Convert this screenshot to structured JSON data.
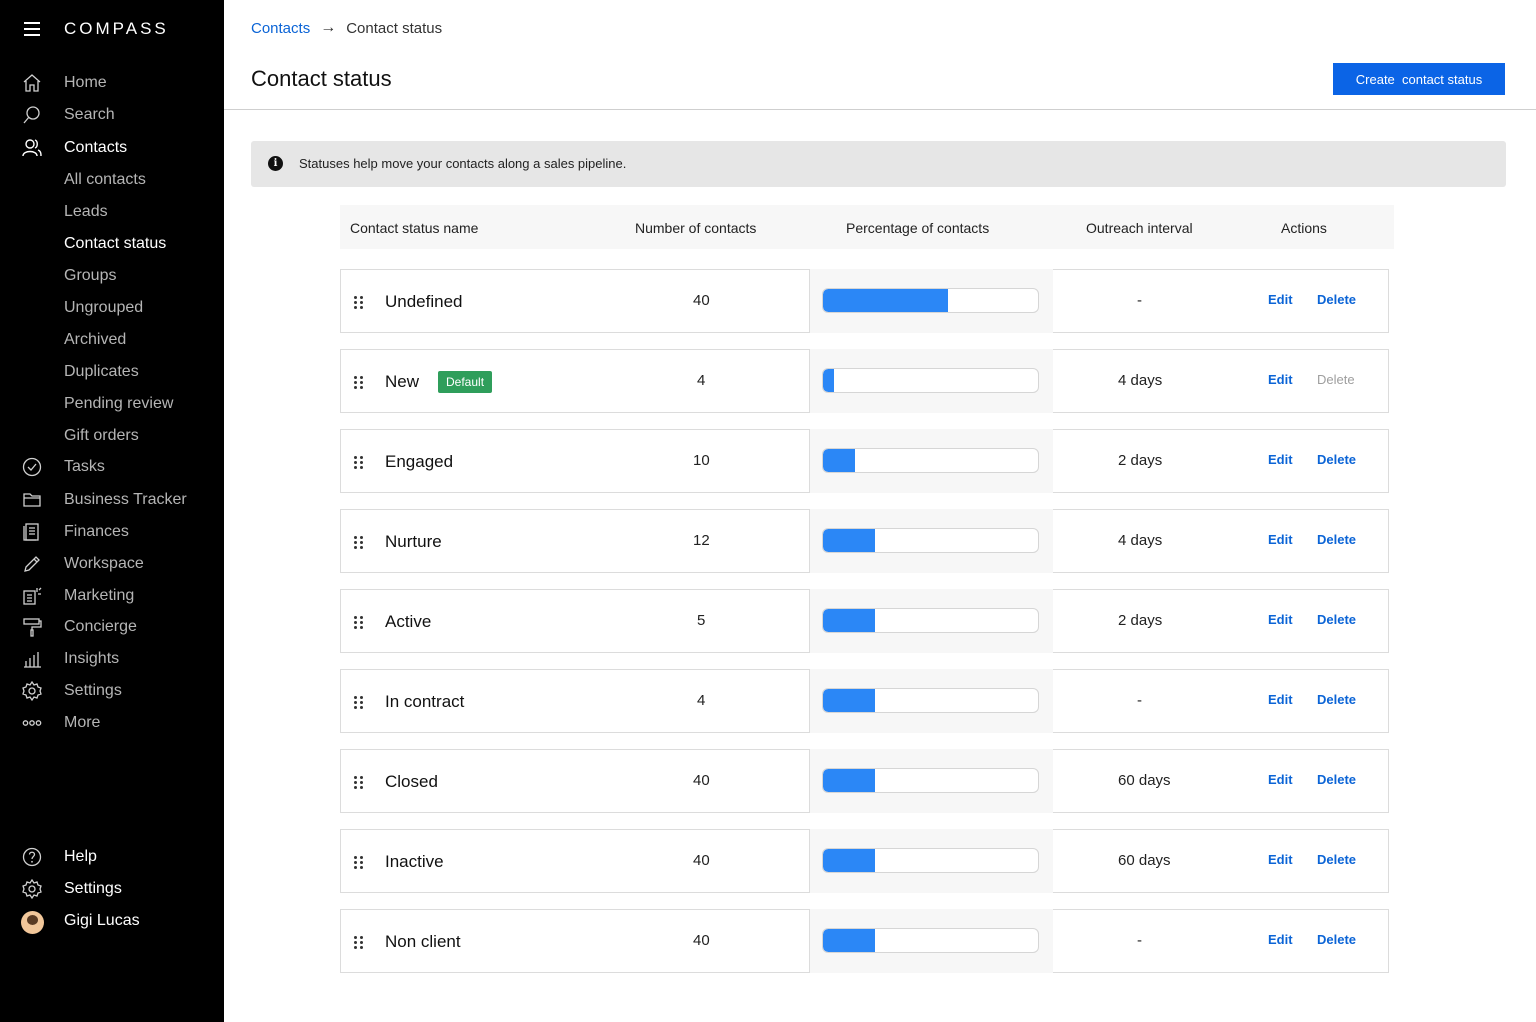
{
  "app": {
    "logo": "COMPASS"
  },
  "sidebar": {
    "items": [
      {
        "label": "Home",
        "icon": "home-icon"
      },
      {
        "label": "Search",
        "icon": "search-icon"
      },
      {
        "label": "Contacts",
        "icon": "contacts-icon",
        "active": true
      },
      {
        "label": "All contacts",
        "sub": true
      },
      {
        "label": "Leads",
        "sub": true
      },
      {
        "label": "Contact status",
        "sub": true,
        "active": true
      },
      {
        "label": "Groups",
        "sub": true
      },
      {
        "label": "Ungrouped",
        "sub": true
      },
      {
        "label": "Archived",
        "sub": true
      },
      {
        "label": "Duplicates",
        "sub": true
      },
      {
        "label": "Pending review",
        "sub": true
      },
      {
        "label": "Gift orders",
        "sub": true
      },
      {
        "label": "Tasks",
        "icon": "check-circle-icon"
      },
      {
        "label": "Business Tracker",
        "icon": "folder-icon"
      },
      {
        "label": "Finances",
        "icon": "ledger-icon"
      },
      {
        "label": "Workspace",
        "icon": "pencil-icon"
      },
      {
        "label": "Marketing",
        "icon": "marketing-icon"
      },
      {
        "label": "Concierge",
        "icon": "paint-roller-icon"
      },
      {
        "label": "Insights",
        "icon": "bar-chart-icon"
      },
      {
        "label": "Settings",
        "icon": "gear-icon"
      },
      {
        "label": "More",
        "icon": "more-dots-icon"
      }
    ],
    "footer": [
      {
        "label": "Help",
        "icon": "help-icon"
      },
      {
        "label": "Settings",
        "icon": "gear-icon"
      },
      {
        "label": "Gigi Lucas",
        "icon": "avatar"
      }
    ]
  },
  "header": {
    "breadcrumb_link": "Contacts",
    "breadcrumb_current": "Contact status",
    "title": "Contact status",
    "create_button": "Create  contact status"
  },
  "info": {
    "text": "Statuses help move your contacts along a sales pipeline."
  },
  "table": {
    "columns": [
      "Contact status name",
      "Number of contacts",
      "Percentage of contacts",
      "Outreach interval",
      "Actions"
    ],
    "rows": [
      {
        "name": "Undefined",
        "count": "40",
        "percent": 58,
        "interval": "-",
        "edit": "Edit",
        "delete": "Delete",
        "delete_disabled": false
      },
      {
        "name": "New",
        "badge": "Default",
        "count": "4",
        "percent": 5,
        "interval": "4 days",
        "edit": "Edit",
        "delete": "Delete",
        "delete_disabled": true
      },
      {
        "name": "Engaged",
        "count": "10",
        "percent": 15,
        "interval": "2 days",
        "edit": "Edit",
        "delete": "Delete",
        "delete_disabled": false
      },
      {
        "name": "Nurture",
        "count": "12",
        "percent": 24,
        "interval": "4 days",
        "edit": "Edit",
        "delete": "Delete",
        "delete_disabled": false
      },
      {
        "name": "Active",
        "count": "5",
        "percent": 24,
        "interval": "2 days",
        "edit": "Edit",
        "delete": "Delete",
        "delete_disabled": false
      },
      {
        "name": "In contract",
        "count": "4",
        "percent": 24,
        "interval": "-",
        "edit": "Edit",
        "delete": "Delete",
        "delete_disabled": false
      },
      {
        "name": "Closed",
        "count": "40",
        "percent": 24,
        "interval": "60 days",
        "edit": "Edit",
        "delete": "Delete",
        "delete_disabled": false
      },
      {
        "name": "Inactive",
        "count": "40",
        "percent": 24,
        "interval": "60 days",
        "edit": "Edit",
        "delete": "Delete",
        "delete_disabled": false
      },
      {
        "name": "Non client",
        "count": "40",
        "percent": 24,
        "interval": "-",
        "edit": "Edit",
        "delete": "Delete",
        "delete_disabled": false
      }
    ]
  },
  "colors": {
    "accent": "#0b64e6",
    "bar": "#2b87f6",
    "badge": "#2f9e5b",
    "sidebar": "#000000"
  }
}
